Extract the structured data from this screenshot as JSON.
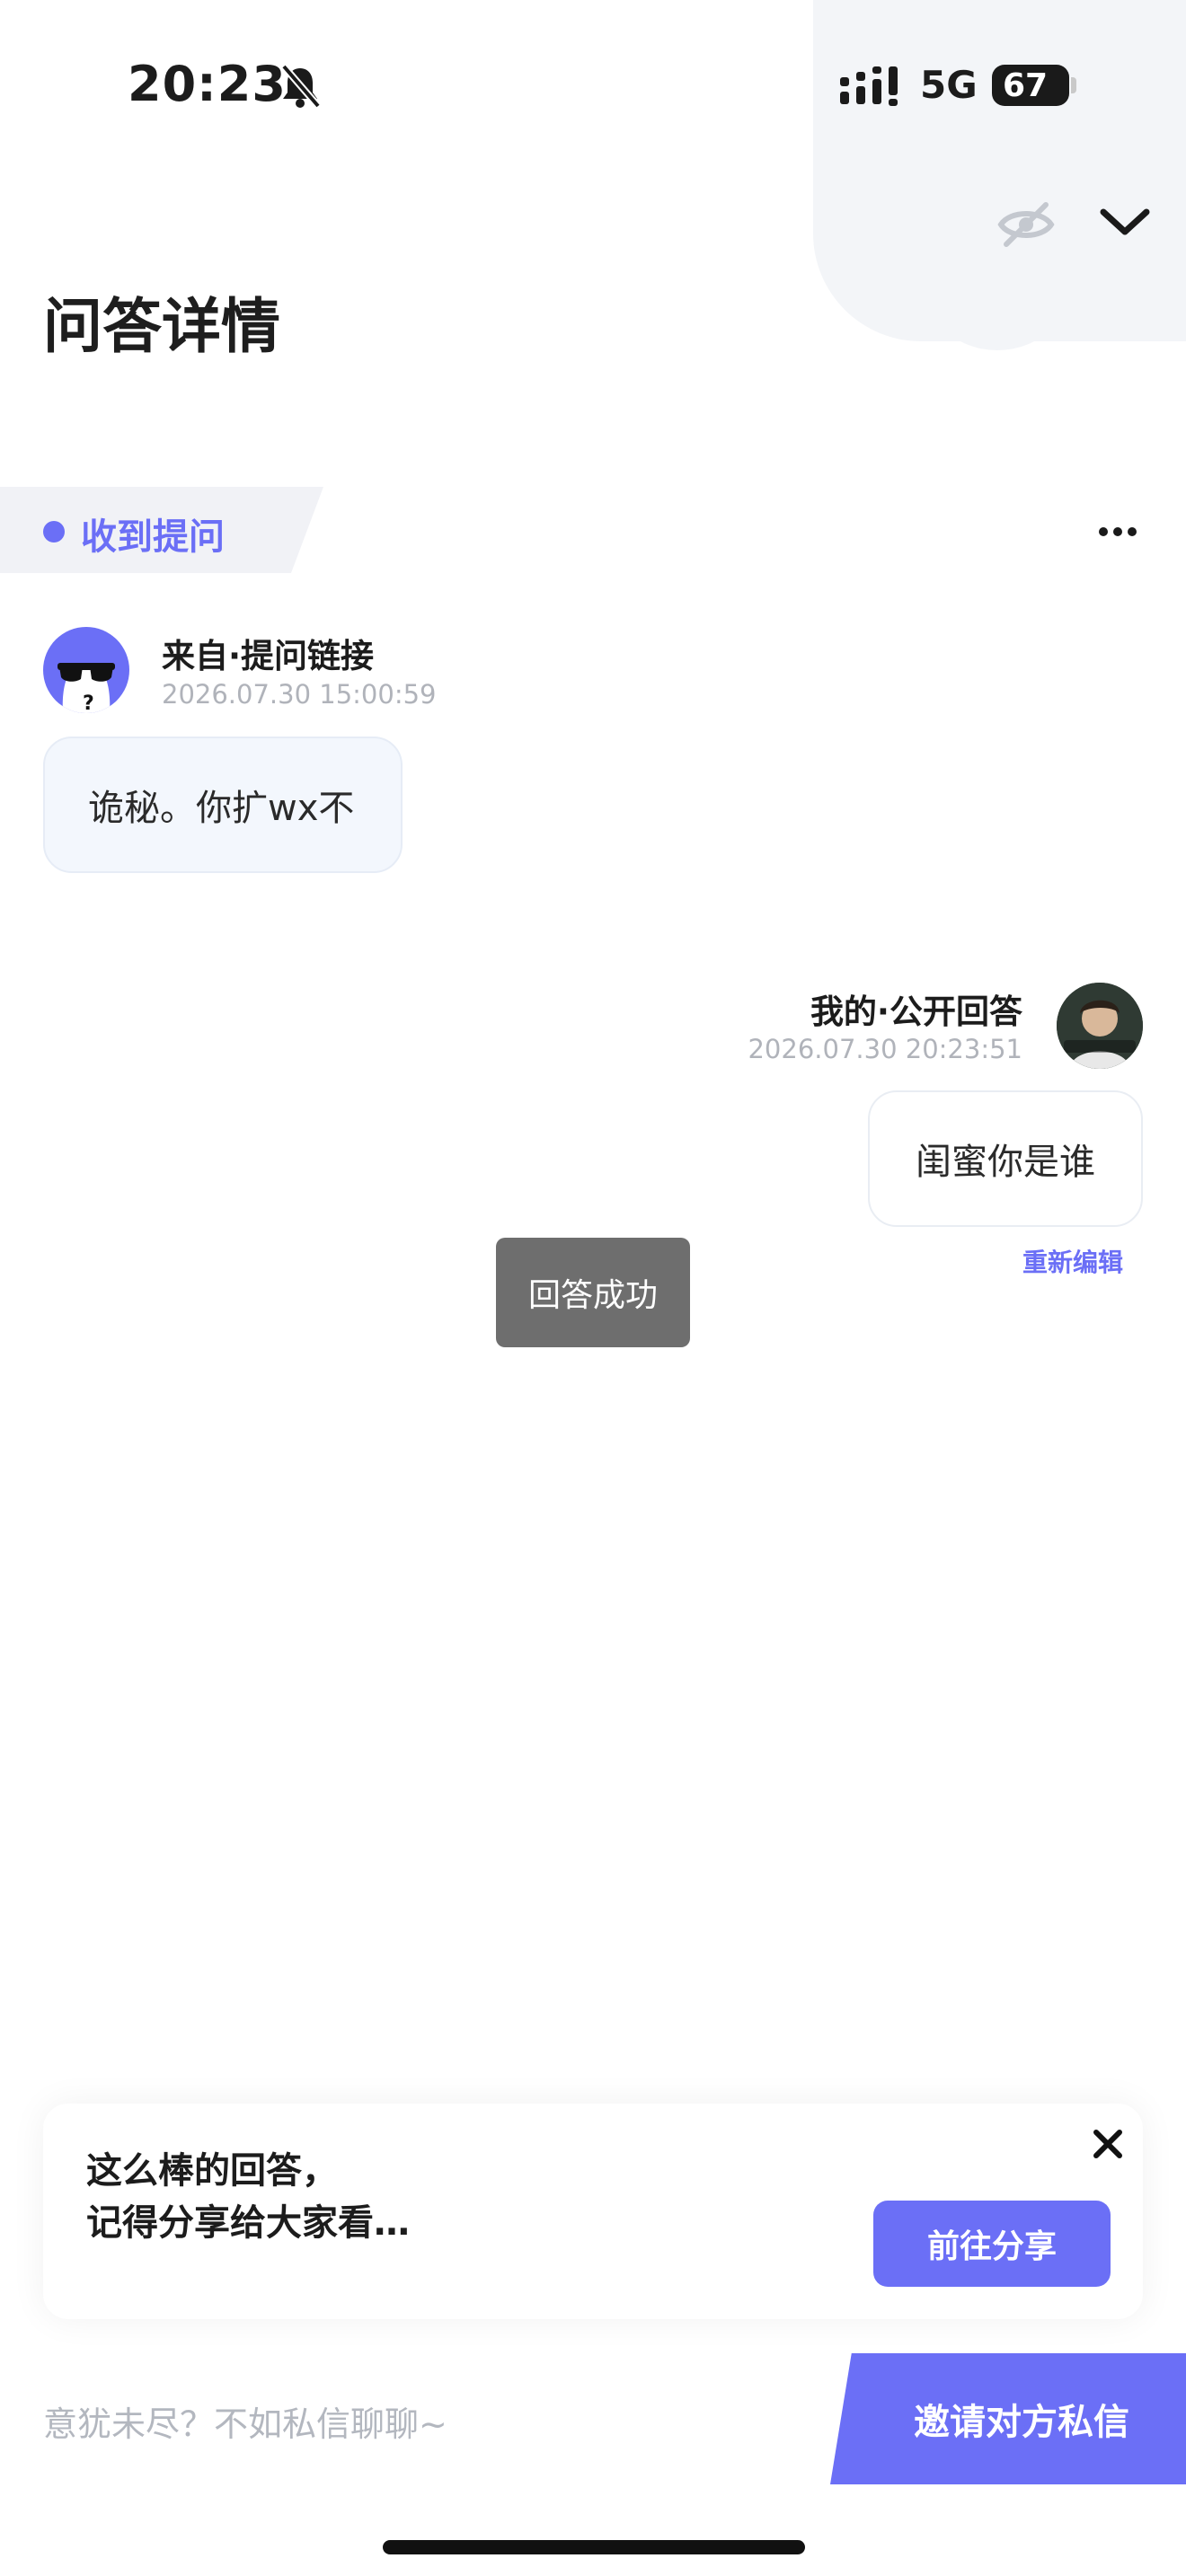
{
  "status_bar": {
    "time": "20:23",
    "network": "5G",
    "battery": "67"
  },
  "header": {
    "title": "问答详情"
  },
  "question": {
    "tag": "收到提问",
    "from": "来自·提问链接",
    "timestamp": "2026.07.30 15:00:59",
    "text": "诡秘。你扩wx不"
  },
  "answer": {
    "from": "我的·公开回答",
    "timestamp": "2026.07.30 20:23:51",
    "text": "闺蜜你是谁",
    "reedit_label": "重新编辑"
  },
  "toast": {
    "text": "回答成功"
  },
  "share_card": {
    "line1": "这么棒的回答，",
    "line2": "记得分享给大家看…",
    "button": "前往分享"
  },
  "bottom_bar": {
    "placeholder": "意犹未尽？不如私信聊聊~",
    "invite_button": "邀请对方私信"
  },
  "colors": {
    "accent": "#6b6ff6",
    "toast_bg": "#6e6e6e"
  },
  "icons": [
    "bell-muted-icon",
    "signal-icon",
    "hide-icon",
    "chevron-down-icon",
    "more-icon",
    "close-icon"
  ]
}
